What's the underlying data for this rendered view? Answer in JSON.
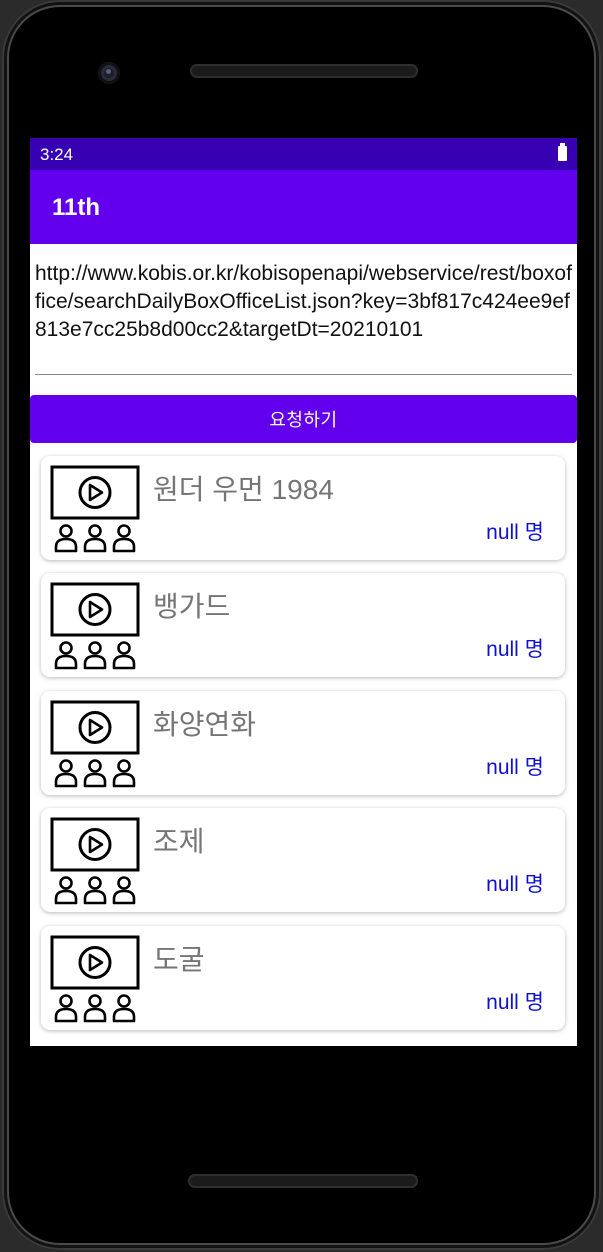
{
  "status_bar": {
    "time": "3:24",
    "battery_icon": "battery-full-icon"
  },
  "app_bar": {
    "title": "11th"
  },
  "url_field": {
    "value": "http://www.kobis.or.kr/kobisopenapi/webservice/rest/boxoffice/searchDailyBoxOfficeList.json?key=3bf817c424ee9ef813e7cc25b8d00cc2&targetDt=20210101"
  },
  "request_button": {
    "label": "요청하기"
  },
  "movies": [
    {
      "title": "원더 우먼 1984",
      "audience": "null 명",
      "icon": "cinema-screen-icon"
    },
    {
      "title": "뱅가드",
      "audience": "null 명",
      "icon": "cinema-screen-icon"
    },
    {
      "title": "화양연화",
      "audience": "null 명",
      "icon": "cinema-screen-icon"
    },
    {
      "title": "조제",
      "audience": "null 명",
      "icon": "cinema-screen-icon"
    },
    {
      "title": "도굴",
      "audience": "null 명",
      "icon": "cinema-screen-icon"
    }
  ],
  "colors": {
    "status_bar": "#3700b3",
    "primary": "#6200ee",
    "audience_text": "#1010d0",
    "title_text": "#757575"
  }
}
